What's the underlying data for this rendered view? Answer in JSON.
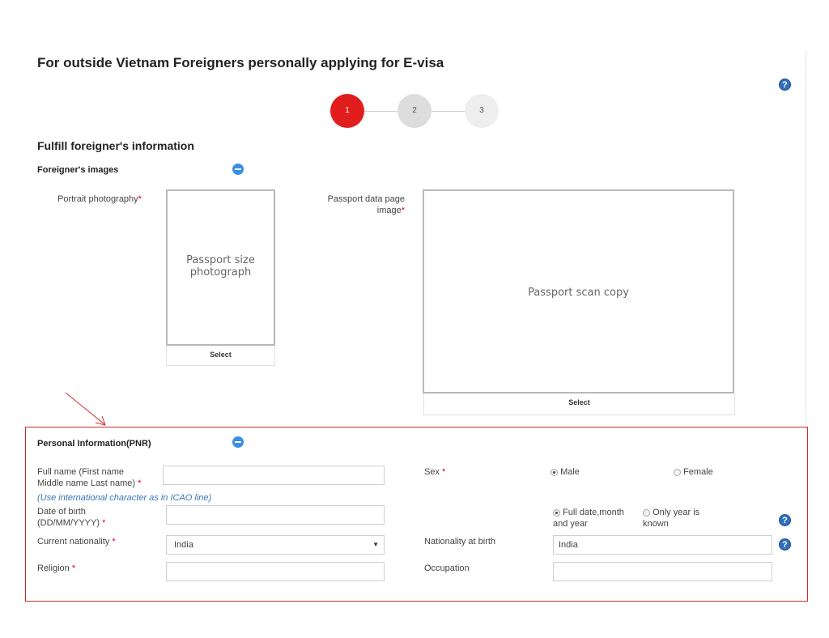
{
  "page": {
    "title": "For outside Vietnam Foreigners personally applying for E-visa",
    "help_icon": "question-circle-icon"
  },
  "steps": [
    "1",
    "2",
    "3"
  ],
  "current_step": 1,
  "form": {
    "section_title": "Fulfill foreigner's information",
    "images": {
      "title": "Foreigner's images",
      "portrait_label": "Portrait photography",
      "portrait_placeholder": "Passport size photograph",
      "portrait_select": "Select",
      "passport_label_line1": "Passport data page",
      "passport_label_line2": "image",
      "passport_placeholder": "Passport scan copy",
      "passport_select": "Select"
    },
    "pnr": {
      "title": "Personal Information(PNR)",
      "full_name_label_line1": "Full name (First name",
      "full_name_label_line2": "Middle name Last name)",
      "full_name_value": "",
      "full_name_hint": "(Use international character as in ICAO line)",
      "dob_label_line1": "Date of birth",
      "dob_label_line2": "(DD/MM/YYYY)",
      "dob_value": "",
      "nationality_label": "Current nationality",
      "nationality_value": "India",
      "religion_label": "Religion",
      "religion_value": "",
      "sex_label": "Sex",
      "sex_options": [
        "Male",
        "Female"
      ],
      "sex_selected": "Male",
      "dob_mode_option1_line1": "Full date,month",
      "dob_mode_option1_line2": "and year",
      "dob_mode_option2_line1": "Only year is",
      "dob_mode_option2_line2": "known",
      "dob_mode_selected": "Full date,month and year",
      "nationality_birth_label": "Nationality at birth",
      "nationality_birth_value": "India",
      "occupation_label": "Occupation",
      "occupation_value": "",
      "required_mark": "*"
    }
  },
  "colors": {
    "accent_red": "#e11d1d",
    "highlight_border": "#d42a2a",
    "help_blue": "#2f6fba",
    "collapse_blue": "#3a8ee6"
  }
}
